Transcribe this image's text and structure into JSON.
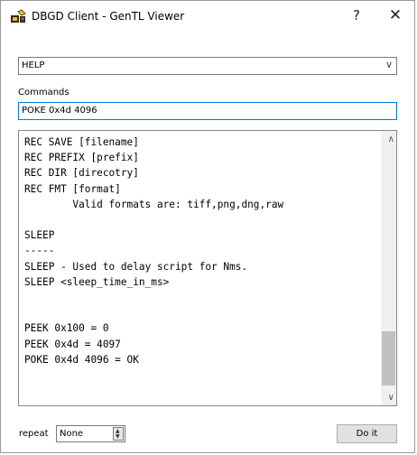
{
  "window": {
    "title": "DBGD Client - GenTL Viewer",
    "help_label": "?",
    "close_label": "✕"
  },
  "command_select": {
    "value": "HELP"
  },
  "commands": {
    "label": "Commands",
    "value": "POKE 0x4d 4096"
  },
  "output": {
    "lines": [
      "REC SAVE [filename]",
      "REC PREFIX [prefix]",
      "REC DIR [direcotry]",
      "REC FMT [format]",
      "        Valid formats are: tiff,png,dng,raw",
      "",
      "SLEEP",
      "-----",
      "SLEEP - Used to delay script for Nms.",
      "SLEEP <sleep_time_in_ms>",
      "",
      "",
      "PEEK 0x100 = 0",
      "PEEK 0x4d = 4097",
      "POKE 0x4d 4096 = OK"
    ]
  },
  "repeat": {
    "label": "repeat",
    "value": "None"
  },
  "do_it_label": "Do it"
}
